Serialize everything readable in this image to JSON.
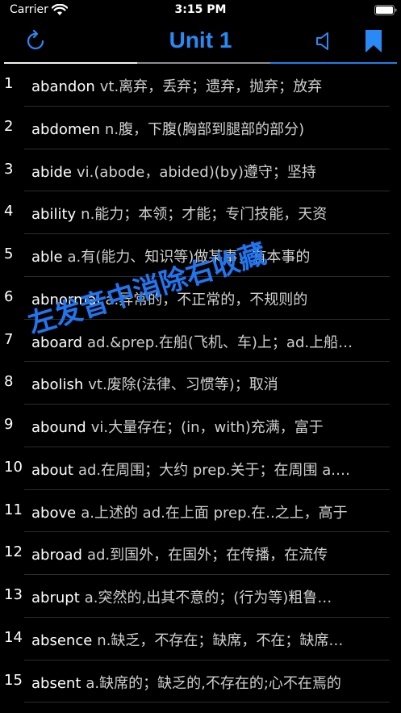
{
  "status_bar": {
    "carrier": "Carrier",
    "time": "3:15 PM",
    "wifi_icon": "wifi-icon",
    "battery_icon": "battery-icon"
  },
  "nav": {
    "title": "Unit 1",
    "left_icon": "refresh-icon",
    "right_icons": [
      "speaker-icon",
      "bookmark-icon"
    ],
    "accent_color": "#2a8af5"
  },
  "words": [
    {
      "num": "1",
      "word": "abandon",
      "def": "vt.离弃，丢弃；遗弃，抛弃；放弃"
    },
    {
      "num": "2",
      "word": "abdomen",
      "def": "n.腹，下腹(胸部到腿部的部分)"
    },
    {
      "num": "3",
      "word": "abide",
      "def": "vi.(abode，abided)(by)遵守；坚持"
    },
    {
      "num": "4",
      "word": "ability",
      "def": "n.能力；本领；才能；专门技能，天资"
    },
    {
      "num": "5",
      "word": "able",
      "def": "a.有(能力、知识等)做某事，有本事的"
    },
    {
      "num": "6",
      "word": "abnormal",
      "def": "a.异常的，不正常的，不规则的"
    },
    {
      "num": "7",
      "word": "aboard",
      "def": "ad.&prep.在船(飞机、车)上；ad.上船…"
    },
    {
      "num": "8",
      "word": "abolish",
      "def": "vt.废除(法律、习惯等)；取消"
    },
    {
      "num": "9",
      "word": "abound",
      "def": "vi.大量存在；(in，with)充满，富于"
    },
    {
      "num": "10",
      "word": "about",
      "def": "ad.在周围；大约 prep.关于；在周围 a.…"
    },
    {
      "num": "11",
      "word": "above",
      "def": "a.上述的 ad.在上面 prep.在..之上，高于"
    },
    {
      "num": "12",
      "word": "abroad",
      "def": "ad.到国外，在国外；在传播，在流传"
    },
    {
      "num": "13",
      "word": "abrupt",
      "def": "a.突然的,出其不意的；(行为等)粗鲁…"
    },
    {
      "num": "14",
      "word": "absence",
      "def": "n.缺乏，不存在；缺席，不在；缺席…"
    },
    {
      "num": "15",
      "word": "absent",
      "def": "a.缺席的；缺乏的,不存在的;心不在焉的"
    }
  ],
  "watermark": "左发音中消除右收藏",
  "colors": {
    "background": "#000000",
    "accent": "#2a8af5",
    "watermark": "#2176f0"
  }
}
